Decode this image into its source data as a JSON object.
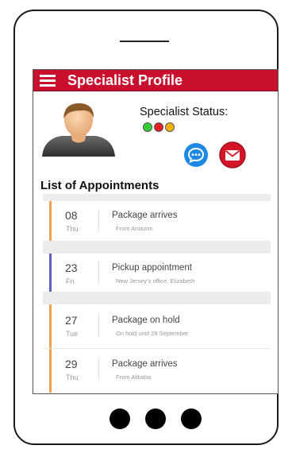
{
  "header": {
    "title": "Specialist Profile"
  },
  "profile": {
    "status_label": "Specialist Status:",
    "status_dots": [
      "#33cc33",
      "#e0201f",
      "#f3b000"
    ]
  },
  "appointments": {
    "heading": "List of Appointments",
    "items": [
      {
        "day": "08",
        "weekday": "Thu",
        "title": "Package arrives",
        "subtitle": "From Amazon",
        "accent": "#f5a04a"
      },
      {
        "day": "23",
        "weekday": "Fri",
        "title": "Pickup appointment",
        "subtitle": "New Jersey's office, Elizabeth",
        "accent": "#5b5fc7"
      },
      {
        "day": "27",
        "weekday": "Tue",
        "title": "Package on hold",
        "subtitle": "On hold until 29 September",
        "accent": "#f5a04a"
      },
      {
        "day": "29",
        "weekday": "Thu",
        "title": "Package arrives",
        "subtitle": "From Alibaba",
        "accent": "#f5a04a"
      }
    ]
  },
  "icons": {
    "menu": "hamburger-icon",
    "chat": "chat-bubble-icon",
    "mail": "envelope-icon",
    "avatar": "user-avatar-icon"
  }
}
